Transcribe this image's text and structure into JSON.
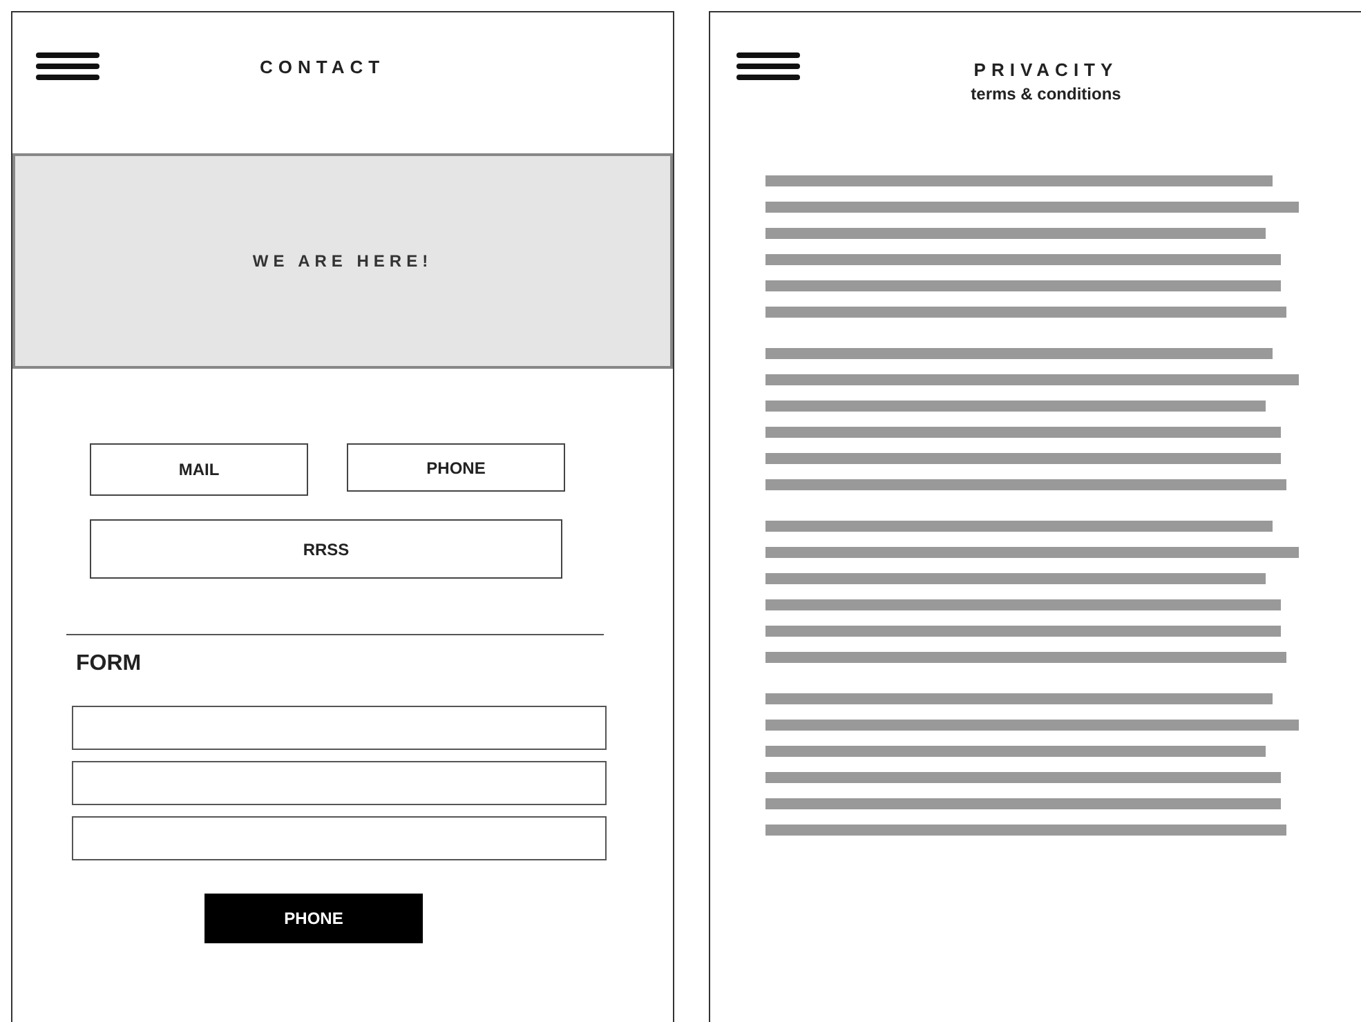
{
  "screens": [
    {
      "kind": "contact",
      "title": "CONTACT",
      "map": {
        "label": "WE ARE HERE!"
      },
      "buttons": [
        "MAIL",
        "PHONE",
        "RRSS"
      ],
      "form": {
        "title": "FORM",
        "fields": [
          {
            "kind": "input"
          },
          {
            "kind": "input"
          },
          {
            "kind": "input"
          }
        ],
        "submit": "PHONE"
      }
    },
    {
      "kind": "privacy",
      "title": "PRIVACITY",
      "subtitle": "terms & conditions"
    }
  ]
}
